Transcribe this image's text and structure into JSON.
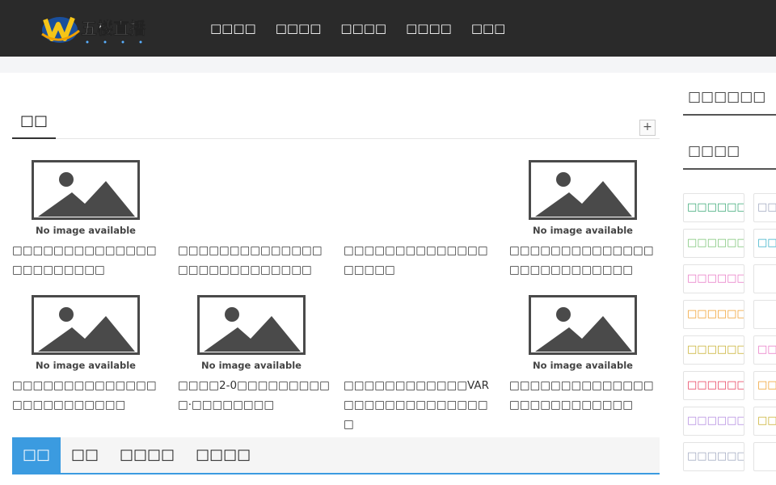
{
  "header": {
    "logo_text": "五楼直播",
    "nav": [
      "□□□□",
      "□□□□",
      "□□□□",
      "□□□□",
      "□□□"
    ]
  },
  "section": {
    "title": "□□",
    "expand_symbol": "+"
  },
  "placeholder_caption": "No image available",
  "cards": [
    {
      "has_image": true,
      "title": "□□□□□□□□□□□□□□□□□□□□□□□"
    },
    {
      "has_image": false,
      "title": "□□□□□□□□□□□□□□□□□□□□□□□□□□□"
    },
    {
      "has_image": false,
      "title": "□□□□□□□□□□□□□□□□□□□"
    },
    {
      "has_image": true,
      "title": "□□□□□□□□□□□□□□□□□□□□□□□□□□"
    },
    {
      "has_image": true,
      "title": "□□□□□□□□□□□□□□□□□□□□□□□□□"
    },
    {
      "has_image": true,
      "title": "□□□□2-0□□□□□□□□□□·□□□□□□□□"
    },
    {
      "has_image": false,
      "title": "□□□□□□□□□□□□VAR□□□□□□□□□□□□□□□"
    },
    {
      "has_image": true,
      "title": "□□□□□□□□□□□□□□□□□□□□□□□□□□"
    }
  ],
  "tabs": [
    "□□",
    "□□",
    "□□□□",
    "□□□□"
  ],
  "sidebar": {
    "head1": "□□□□□□",
    "head2": "□□□□",
    "tags_left": [
      {
        "text": "□□□□□□□□",
        "color": "#3aa876"
      },
      {
        "text": "□□□□□□□",
        "color": "#7cc576"
      },
      {
        "text": "□□□□□□□□",
        "color": "#e879c6"
      },
      {
        "text": "□□□□□□□□",
        "color": "#f0a030"
      },
      {
        "text": "□□□□□□□",
        "color": "#c8b030"
      },
      {
        "text": "□□□□□□□□",
        "color": "#e83a5a"
      },
      {
        "text": "□□□□□□□□",
        "color": "#b48ce0"
      },
      {
        "text": "□□□□□□",
        "color": "#a0a8c0"
      }
    ],
    "tags_right": [
      {
        "text": "□□□",
        "color": "#a0a8c0"
      },
      {
        "text": "□□□",
        "color": "#38b0c8"
      },
      {
        "text": "",
        "color": "#cccccc"
      },
      {
        "text": "",
        "color": "#cccccc"
      },
      {
        "text": "□□□",
        "color": "#e879c6"
      },
      {
        "text": "□□□",
        "color": "#f0a030"
      },
      {
        "text": "□□□",
        "color": "#c8b030"
      },
      {
        "text": "",
        "color": "#cccccc"
      }
    ]
  }
}
